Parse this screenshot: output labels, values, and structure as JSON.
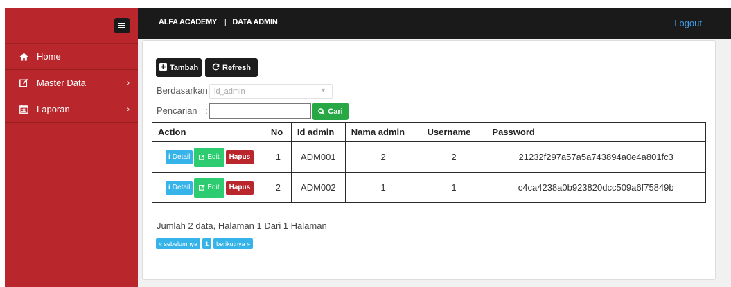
{
  "topbar": {
    "brand": "ALFA ACADEMY",
    "separator": "|",
    "section": "DATA ADMIN",
    "logout": "Logout"
  },
  "sidebar": {
    "items": [
      {
        "label": "Home",
        "icon": "home-icon"
      },
      {
        "label": "Master Data",
        "icon": "edit-icon",
        "chevron": "›"
      },
      {
        "label": "Laporan",
        "icon": "calendar-icon",
        "chevron": "›"
      }
    ]
  },
  "toolbar": {
    "add_label": "Tambah",
    "refresh_label": "Refresh"
  },
  "filter": {
    "by_label": "Berdasarkan:",
    "by_value": "id_admin",
    "search_label": "Pencarian",
    "search_colon": ":",
    "search_value": "",
    "search_button": "Cari"
  },
  "table": {
    "headers": [
      "Action",
      "No",
      "Id admin",
      "Nama admin",
      "Username",
      "Password"
    ],
    "action_labels": {
      "detail": "Detail",
      "edit": "Edit",
      "delete": "Hapus"
    },
    "rows": [
      {
        "no": "1",
        "id": "ADM001",
        "nama": "2",
        "username": "2",
        "password": "21232f297a57a5a743894a0e4a801fc3"
      },
      {
        "no": "2",
        "id": "ADM002",
        "nama": "1",
        "username": "1",
        "password": "c4ca4238a0b923820dcc509a6f75849b"
      }
    ]
  },
  "footer": {
    "info": "Jumlah 2 data, Halaman 1 Dari 1 Halaman",
    "prev": "« sebelumnya",
    "page": "1",
    "next": "berikutnya »"
  },
  "colors": {
    "sidebar": "#b9262c",
    "topbar": "#1a1a1a",
    "accent_green": "#28a745",
    "accent_blue": "#36b3e8",
    "danger": "#b9262c"
  }
}
